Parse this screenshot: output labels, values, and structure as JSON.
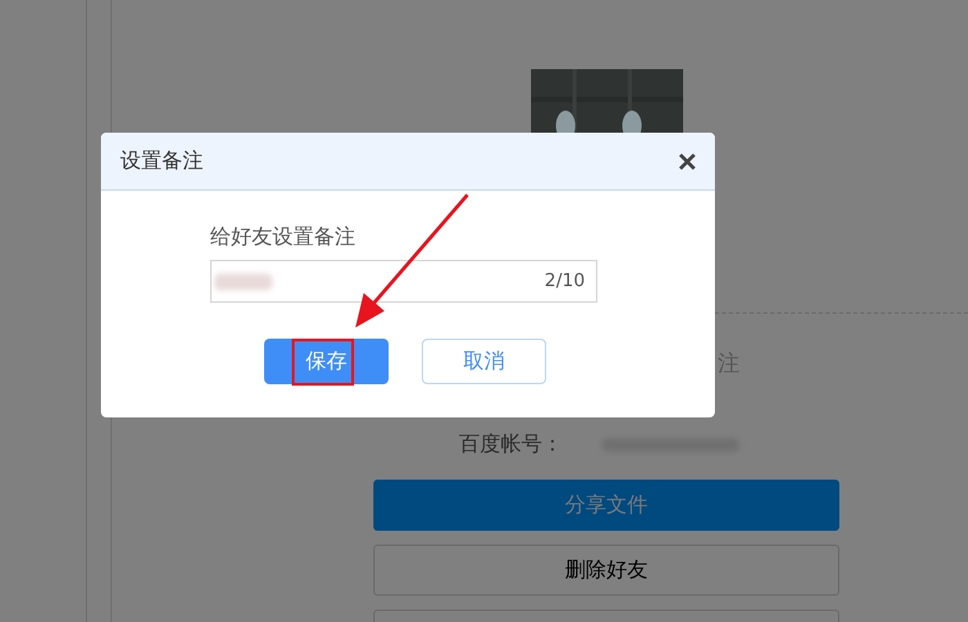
{
  "profile": {
    "note_fragment": "注",
    "account_label": "百度帐号：",
    "actions": [
      {
        "label": "分享文件",
        "kind": "primary"
      },
      {
        "label": "删除好友",
        "kind": "outline"
      },
      {
        "kind": "outline"
      }
    ]
  },
  "dialog": {
    "title": "设置备注",
    "field_label": "给好友设置备注",
    "field": {
      "counter": "2/10"
    },
    "buttons": [
      {
        "label": "保存",
        "kind": "primary",
        "highlighted": true
      },
      {
        "label": "取消",
        "kind": "secondary",
        "highlighted": false
      }
    ]
  },
  "annotations": [
    {
      "kind": "arrow"
    }
  ]
}
